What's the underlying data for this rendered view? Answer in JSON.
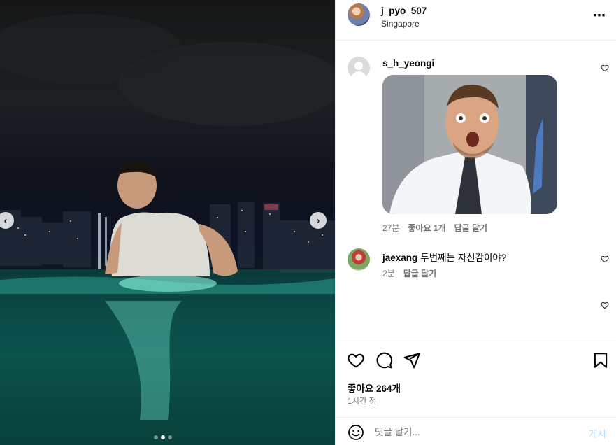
{
  "post": {
    "username": "j_pyo_507",
    "location": "Singapore",
    "more_icon": "⋯"
  },
  "media": {
    "slide_count": 3,
    "active_slide": 1,
    "prev_icon": "chevron-left-icon",
    "next_icon": "chevron-right-icon",
    "prev_glyph": "‹",
    "next_glyph": "›"
  },
  "comments": [
    {
      "username": "s_h_yeongi",
      "text": "",
      "has_gif": true,
      "time": "27분",
      "likes_label": "좋아요 1개",
      "reply_label": "답글 달기"
    },
    {
      "username": "jaexang",
      "text": "두번째는 자신감이야?",
      "time": "2분",
      "reply_label": "답글 달기"
    }
  ],
  "actions": {
    "likes": "좋아요 264개",
    "time": "1시간 전"
  },
  "comment_bar": {
    "placeholder": "댓글 달기...",
    "post_label": "게시"
  },
  "colors": {
    "link_blue_disabled": "#b2dffc",
    "meta_gray": "#737373",
    "border": "#efefef"
  }
}
